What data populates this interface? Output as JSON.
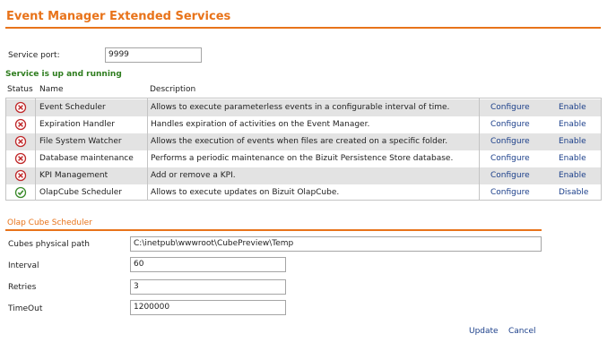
{
  "page": {
    "title": "Event Manager Extended Services",
    "service_port_label": "Service port:",
    "service_port_value": "9999",
    "status_message": "Service is up and running"
  },
  "table": {
    "headers": {
      "status": "Status",
      "name": "Name",
      "description": "Description"
    },
    "rows": [
      {
        "status": "error",
        "name": "Event Scheduler",
        "description": "Allows to execute parameterless events in a configurable interval of time.",
        "configure": "Configure",
        "toggle": "Enable"
      },
      {
        "status": "error",
        "name": "Expiration Handler",
        "description": "Handles expiration of activities on the Event Manager.",
        "configure": "Configure",
        "toggle": "Enable"
      },
      {
        "status": "error",
        "name": "File System Watcher",
        "description": "Allows the execution of events when files are created on a specific folder.",
        "configure": "Configure",
        "toggle": "Enable"
      },
      {
        "status": "error",
        "name": "Database maintenance",
        "description": "Performs a periodic maintenance on the Bizuit Persistence Store database.",
        "configure": "Configure",
        "toggle": "Enable"
      },
      {
        "status": "error",
        "name": "KPI Management",
        "description": "Add or remove a KPI.",
        "configure": "Configure",
        "toggle": "Enable"
      },
      {
        "status": "ok",
        "name": "OlapCube Scheduler",
        "description": "Allows to execute updates on Bizuit OlapCube.",
        "configure": "Configure",
        "toggle": "Disable"
      }
    ]
  },
  "olap": {
    "section_title": "Olap Cube Scheduler",
    "cubes_path_label": "Cubes physical path",
    "cubes_path_value": "C:\\inetpub\\wwwroot\\CubePreview\\Temp",
    "interval_label": "Interval",
    "interval_value": "60",
    "retries_label": "Retries",
    "retries_value": "3",
    "timeout_label": "TimeOut",
    "timeout_value": "1200000",
    "update_label": "Update",
    "cancel_label": "Cancel"
  },
  "colors": {
    "accent": "#e8731a",
    "status_ok": "#2e7d1e",
    "error_icon": "#c0282a",
    "link": "#1b3f8a"
  }
}
